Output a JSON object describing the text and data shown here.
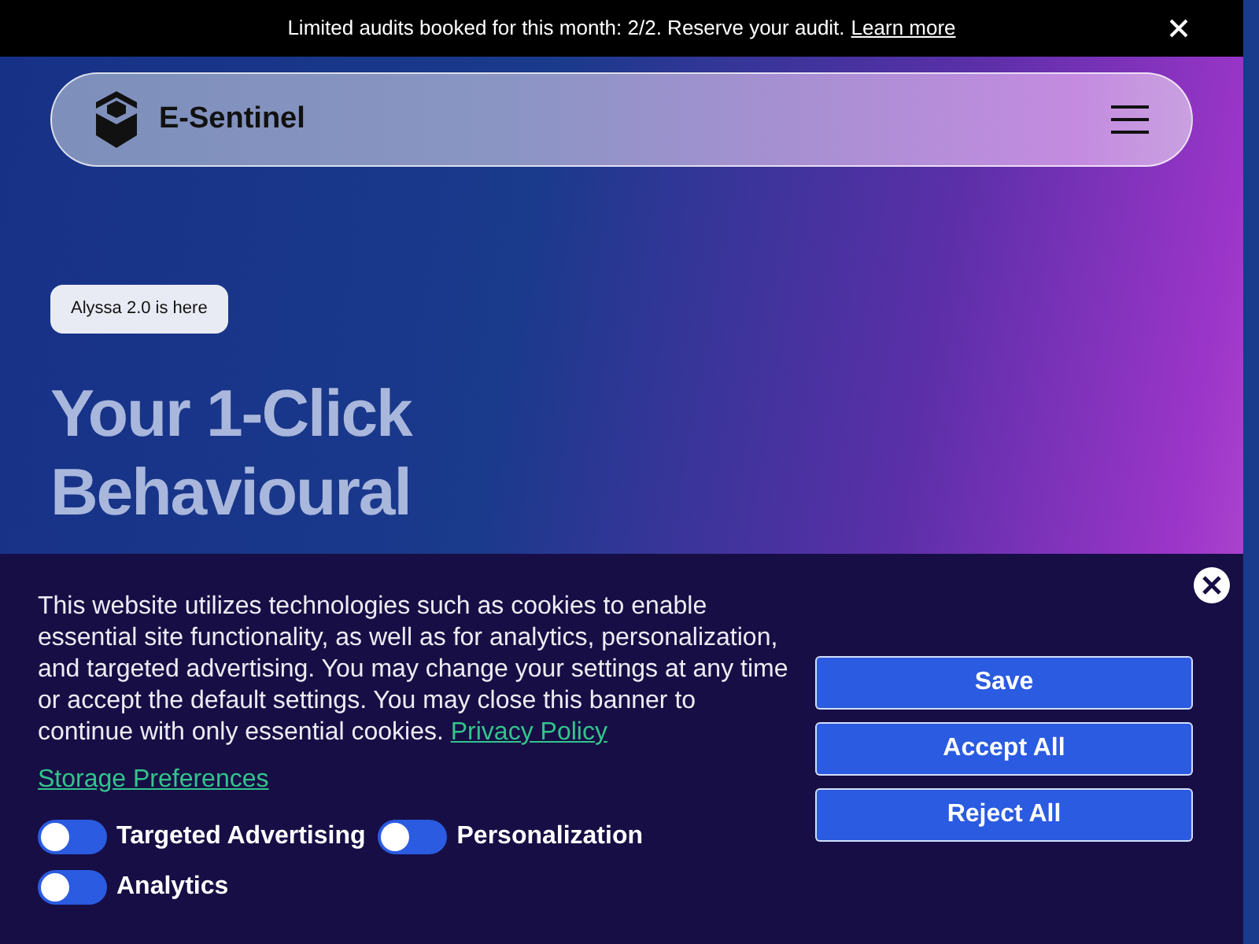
{
  "announcement": {
    "text": "Limited audits booked for this month: 2/2. Reserve your audit.",
    "link": "Learn more"
  },
  "nav": {
    "brand": "E-Sentinel"
  },
  "hero": {
    "badge": "Alyssa 2.0 is here",
    "heading_lines": [
      "Your 1-Click",
      "Behavioural"
    ]
  },
  "cookie_banner": {
    "text": "This website utilizes technologies such as cookies to enable essential site functionality, as well as for analytics, personalization, and targeted advertising. You may change your settings at any time or accept the default settings. You may close this banner to continue with only essential cookies.",
    "policy_link": "Privacy Policy",
    "preferences_link": "Storage Preferences",
    "toggles": [
      {
        "label": "Targeted Advertising",
        "on": false
      },
      {
        "label": "Personalization",
        "on": false
      },
      {
        "label": "Analytics",
        "on": false
      }
    ],
    "buttons": [
      "Save",
      "Accept All",
      "Reject All"
    ]
  }
}
